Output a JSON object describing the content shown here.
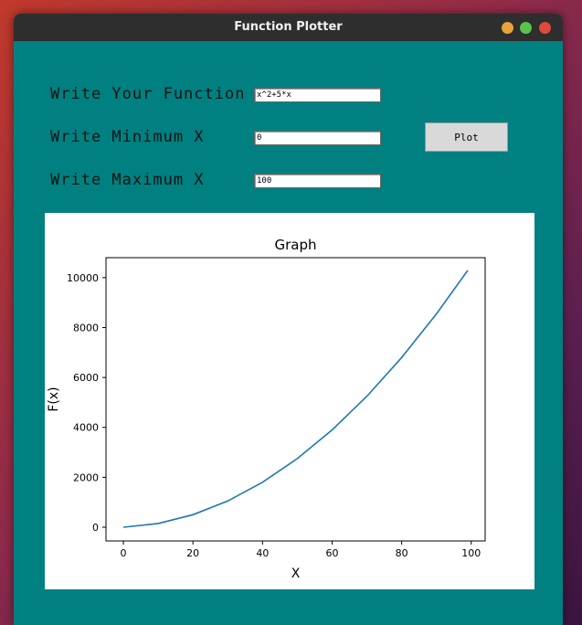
{
  "window": {
    "title": "Function Plotter"
  },
  "form": {
    "function_label": "Write Your Function",
    "function_value": "x^2+5*x",
    "min_label": "Write Minimum X",
    "min_value": "0",
    "max_label": "Write Maximum X",
    "max_value": "100",
    "plot_button": "Plot"
  },
  "chart_data": {
    "type": "line",
    "title": "Graph",
    "xlabel": "X",
    "ylabel": "F(x)",
    "xlim": [
      -5,
      104
    ],
    "ylim": [
      -550,
      10800
    ],
    "xticks": [
      0,
      20,
      40,
      60,
      80,
      100
    ],
    "yticks": [
      0,
      2000,
      4000,
      6000,
      8000,
      10000
    ],
    "series": [
      {
        "color": "#1f77b4",
        "x": [
          0,
          10,
          20,
          30,
          40,
          50,
          60,
          70,
          80,
          90,
          99
        ],
        "y": [
          0,
          150,
          500,
          1050,
          1800,
          2750,
          3900,
          5250,
          6800,
          8550,
          10296
        ]
      }
    ]
  }
}
